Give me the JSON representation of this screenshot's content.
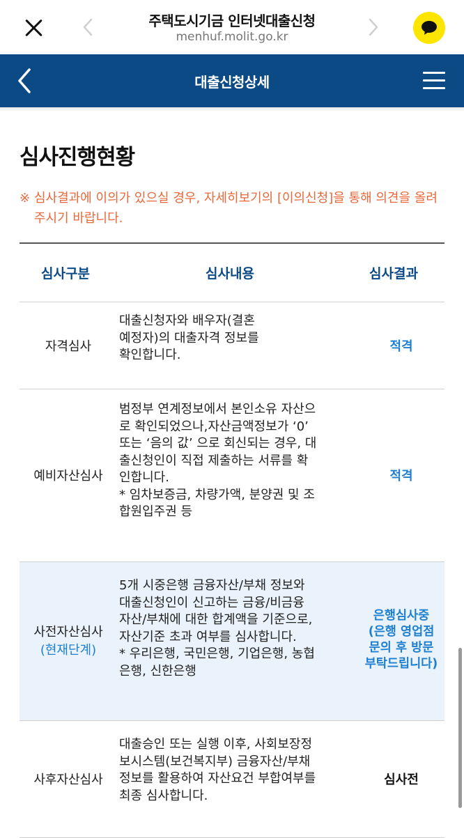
{
  "browser": {
    "title": "주택도시기금 인터넷대출신청",
    "url": "menhuf.molit.go.kr",
    "icons": [
      "close-icon",
      "back-arrow-icon",
      "forward-arrow-icon",
      "kakao-talk-icon"
    ],
    "colors": {
      "kakao": "#FEE500"
    }
  },
  "header": {
    "title": "대출신청상세",
    "colors": {
      "background": "#0c4a86"
    }
  },
  "section": {
    "title": "심사진행현황",
    "notice_mark": "※",
    "notice": "심사결과에 이의가 있으실 경우, 자세히보기의 [이의신청]을 통해 의견을 올려주시기 바랍니다."
  },
  "table": {
    "headers": {
      "category": "심사구분",
      "content": "심사내용",
      "result": "심사결과"
    },
    "rows": [
      {
        "category": "자격심사",
        "content_lines": [
          "대출신청자와 배우자(결혼",
          "예정자)의 대출자격 정보를",
          "확인합니다."
        ],
        "result": "적격"
      },
      {
        "category": "예비자산심사",
        "content_lines": [
          "범정부 연계정보에서 본인소유 자산으",
          "로 확인되었으나,자산금액정보가 ‘0’",
          "또는 ‘음의 값’ 으로 회신되는 경우, 대",
          "출신청인이 직접 제출하는 서류를 확",
          "인합니다.",
          "* 임차보증금, 차량가액, 분양권 및 조",
          "합원입주권 등"
        ],
        "result": "적격"
      },
      {
        "category": "사전자산심사",
        "category_sub": "(현재단계)",
        "content_lines": [
          "5개 시중은행 금융자산/부채 정보와",
          "대출신청인이 신고하는 금융/비금융",
          "자산/부채에 대한 합계액을 기준으로,",
          "자산기준 초과 여부를 심사합니다.",
          "* 우리은행, 국민은행, 기업은행, 농협",
          "은행, 신한은행"
        ],
        "result_lines": [
          "은행심사중",
          "(은행 영업점",
          "문의 후 방문",
          "부탁드립니다)"
        ]
      },
      {
        "category": "사후자산심사",
        "content_lines": [
          "대출승인 또는 실행 이후, 사회보장정",
          "보시스템(보건복지부) 금융자산/부채",
          "정보를 활용하여 자산요건 부합여부를",
          "최종 심사합니다."
        ],
        "result": "심사전"
      }
    ],
    "colors": {
      "accent": "#1e7fd0",
      "header_text": "#0c4a86",
      "current_row_bg": "#eaf3fb",
      "notice": "#e8683c"
    }
  }
}
